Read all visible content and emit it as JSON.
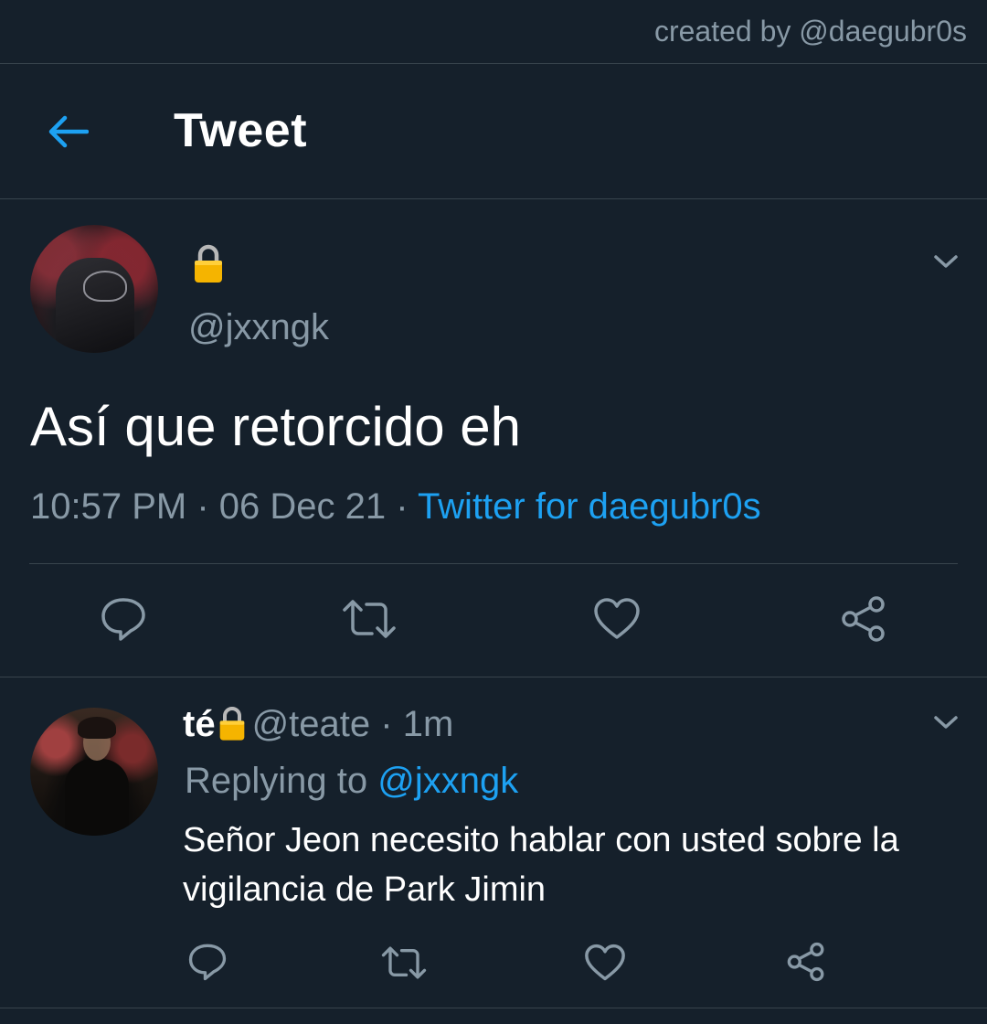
{
  "watermark": "created by @daegubr0s",
  "header": {
    "title": "Tweet",
    "back_icon": "arrow-left-icon"
  },
  "main_tweet": {
    "handle": "@jxxngk",
    "lock_icon": "lock-icon",
    "text": "Así que retorcido eh",
    "time": "10:57 PM",
    "separator": " · ",
    "date": "06 Dec 21",
    "source": "Twitter for daegubr0s",
    "actions": [
      "reply-icon",
      "retweet-icon",
      "like-icon",
      "share-icon"
    ]
  },
  "reply": {
    "name": "té",
    "handle": "@teate",
    "separator": " · ",
    "age": "1m",
    "replying_prefix": "Replying to ",
    "replying_to": "@jxxngk",
    "text": "Señor Jeon necesito hablar con usted sobre la vigilancia de Park Jimin",
    "actions": [
      "reply-icon",
      "retweet-icon",
      "like-icon",
      "share-icon"
    ]
  },
  "colors": {
    "background": "#15202b",
    "accent": "#1da1f2",
    "secondary_text": "#8899a6",
    "divider": "#38444d",
    "lock": "#f5b400"
  }
}
